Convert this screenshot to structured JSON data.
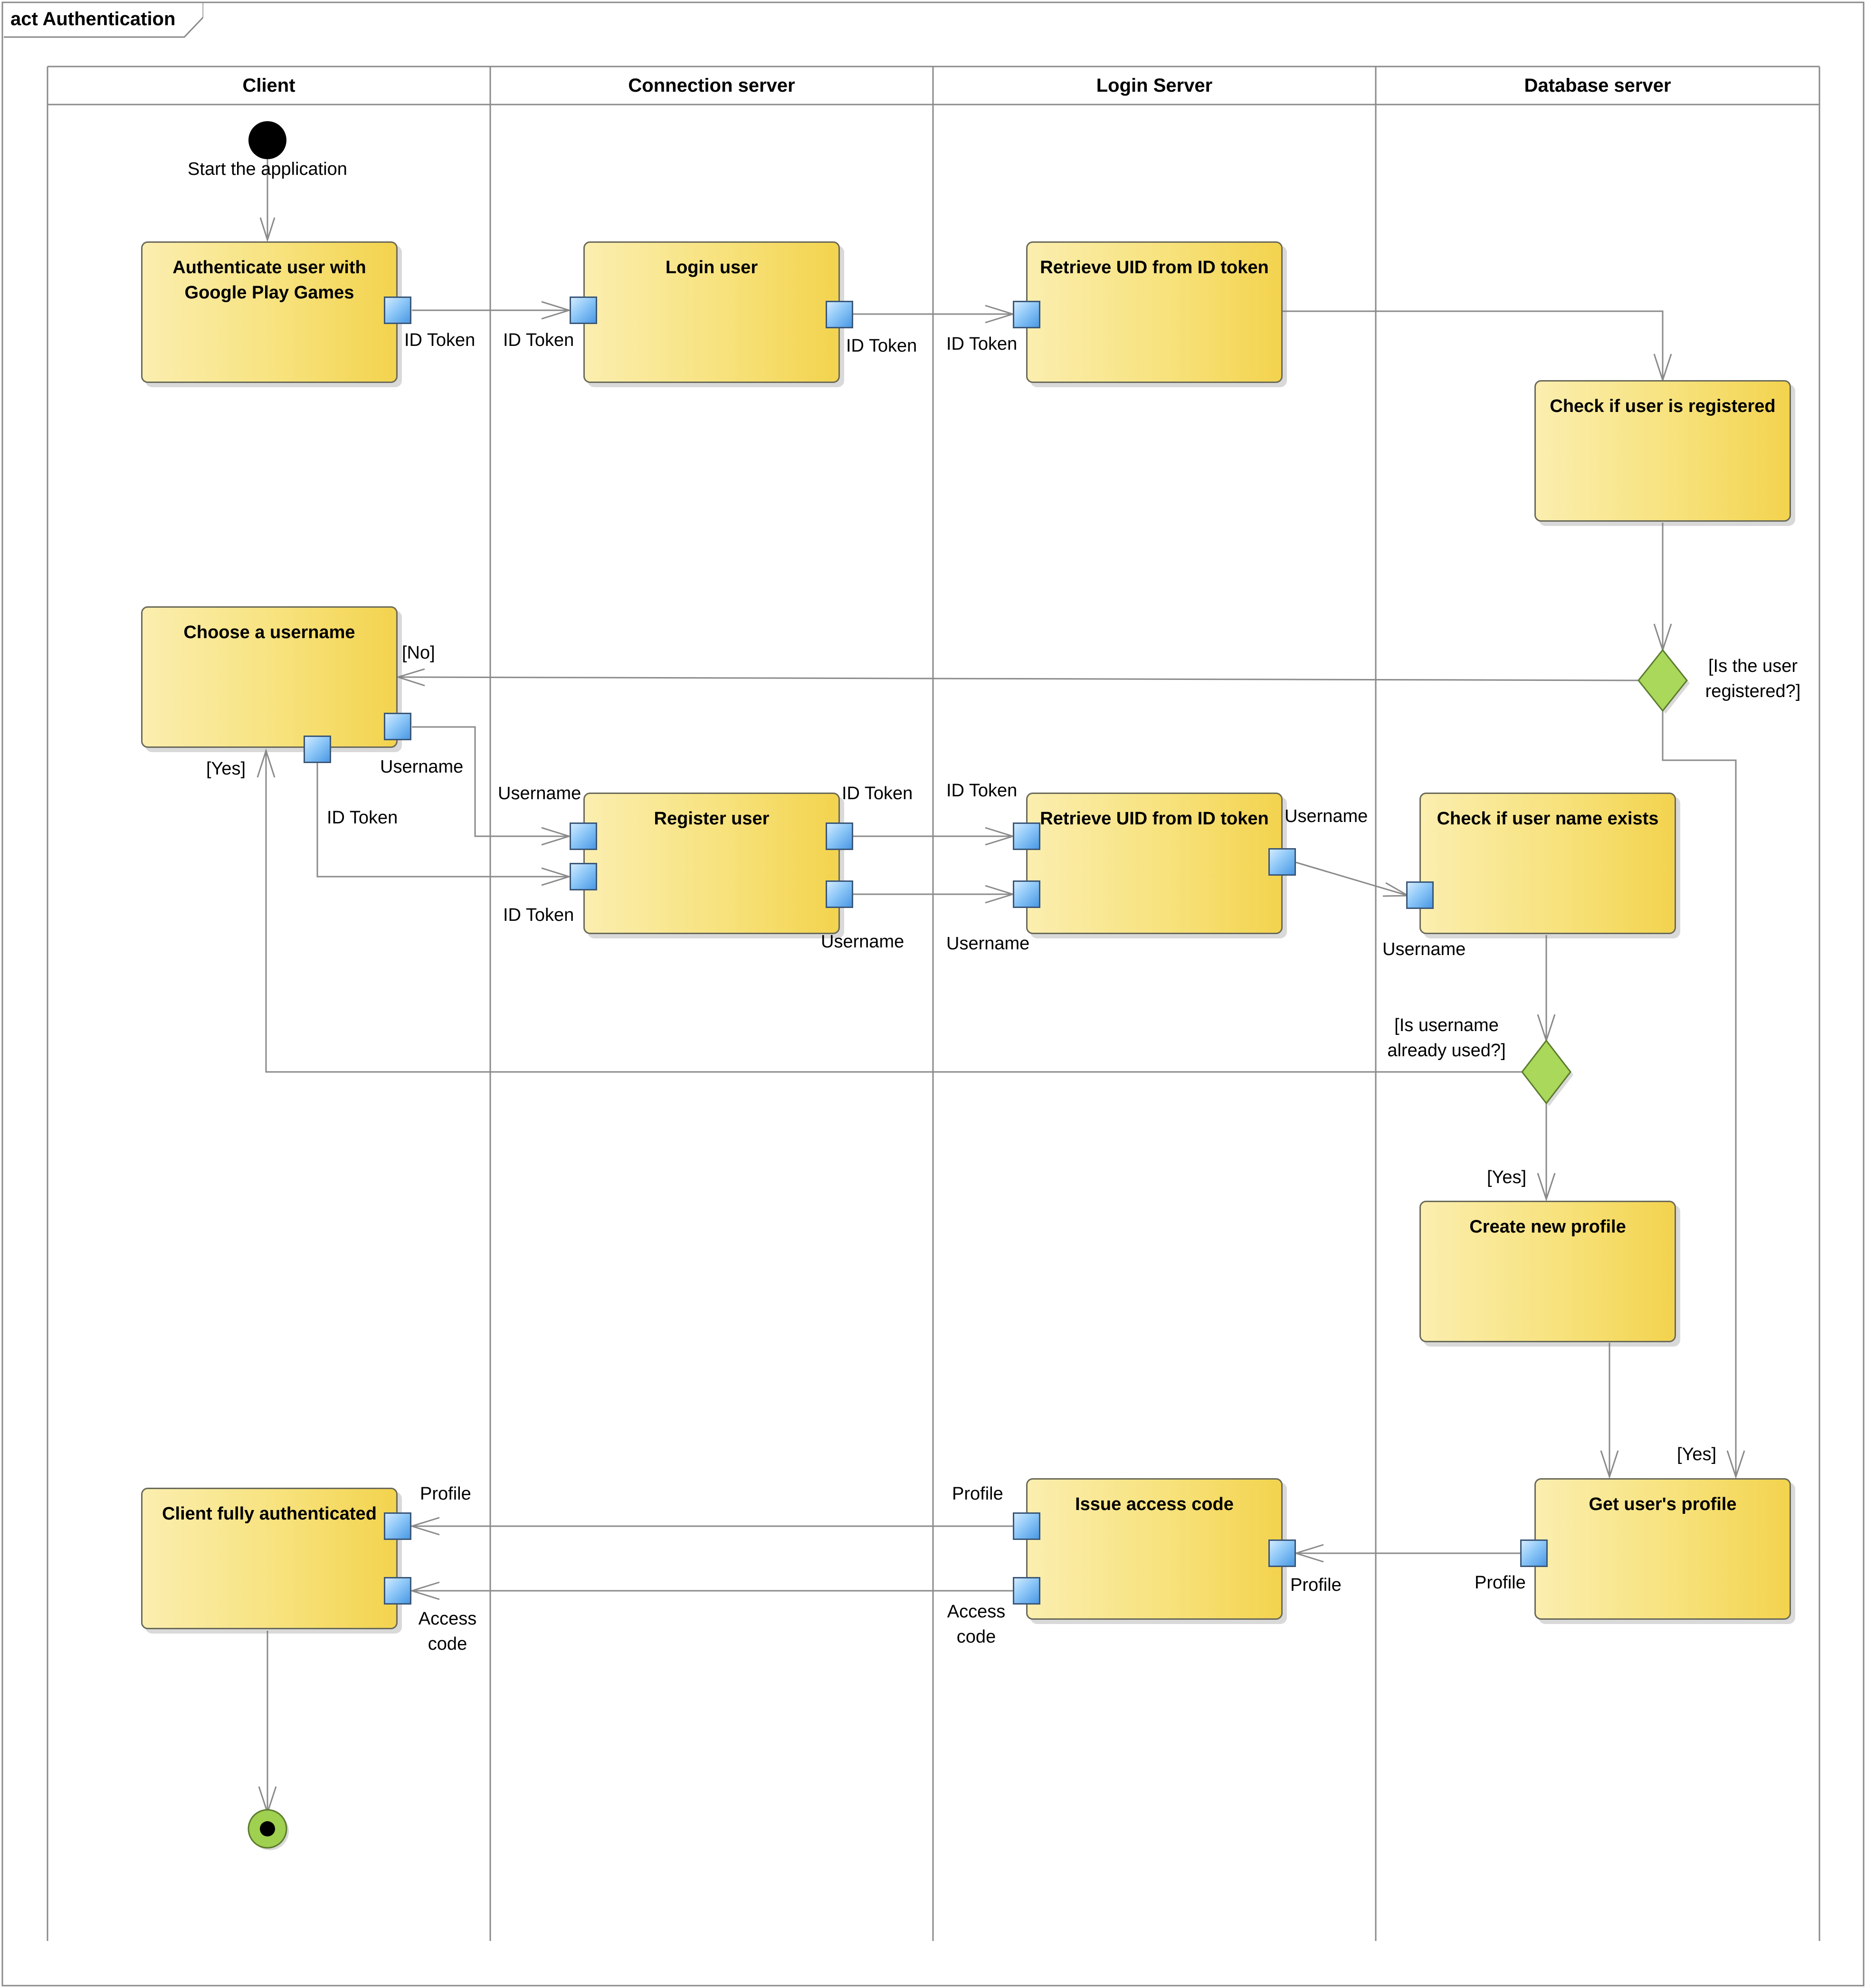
{
  "frame": {
    "title": "act Authentication"
  },
  "lanes": [
    {
      "name": "Client"
    },
    {
      "name": "Connection server"
    },
    {
      "name": "Login Server"
    },
    {
      "name": "Database server"
    }
  ],
  "initial_node": {
    "label": "Start the application"
  },
  "actions": {
    "authenticate": "Authenticate user with Google Play Games",
    "login_user": "Login user",
    "retrieve_uid_1": "Retrieve UID from ID token",
    "check_registered": "Check if user is registered",
    "choose_username": "Choose a username",
    "register_user": "Register user",
    "retrieve_uid_2": "Retrieve UID from ID token",
    "check_username": "Check if user name exists",
    "create_profile": "Create new profile",
    "client_authenticated": "Client fully authenticated",
    "issue_access_code": "Issue access code",
    "get_profile": "Get user's profile"
  },
  "pins": {
    "auth_out": "ID Token",
    "login_in": "ID Token",
    "login_out": "ID Token",
    "retrieve1_in": "ID Token",
    "choose_username_out": "Username",
    "choose_idtoken_out": "ID Token",
    "register_username_in": "Username",
    "register_idtoken_in": "ID Token",
    "register_idtoken_out": "ID Token",
    "register_username_out": "Username",
    "retrieve2_idtoken_in": "ID Token",
    "retrieve2_username_in": "Username",
    "retrieve2_username_out": "Username",
    "check_username_in": "Username",
    "client_profile_in": "Profile",
    "client_access_in": "Access code",
    "issue_profile_out": "Profile",
    "issue_access_out": "Access code",
    "issue_profile_in": "Profile",
    "get_profile_out": "Profile"
  },
  "decisions": {
    "registered": {
      "question": "[Is the user registered?]",
      "no_guard": "[No]",
      "yes_guard": "[Yes]"
    },
    "username_used": {
      "question": "[Is username already used?]",
      "yes_loop_guard": "[Yes]",
      "yes_guard": "[Yes]"
    }
  },
  "colors": {
    "action_fill": "#f7e27c",
    "pin_fill": "#8ec8f8",
    "decision_fill": "#a9d85a",
    "final_fill": "#9fd04f",
    "line": "#8a8a8a"
  }
}
